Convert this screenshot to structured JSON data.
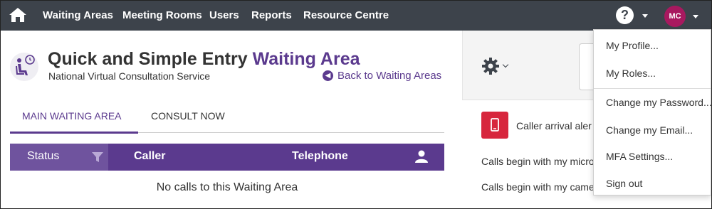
{
  "nav": {
    "items": [
      "Waiting Areas",
      "Meeting Rooms",
      "Users",
      "Reports",
      "Resource Centre"
    ],
    "help_label": "?",
    "avatar_initials": "MC",
    "icons": [
      "home-icon",
      "help-icon",
      "chevron-down-icon"
    ]
  },
  "header": {
    "title_main": "Quick and Simple Entry ",
    "title_accent": "Waiting Area",
    "subtitle": "National Virtual Consultation Service",
    "back_link": "Back to Waiting Areas"
  },
  "tabs": [
    {
      "label": "MAIN WAITING AREA",
      "active": true
    },
    {
      "label": "CONSULT NOW",
      "active": false
    }
  ],
  "table": {
    "columns": [
      "Status",
      "Caller",
      "Telephone"
    ],
    "empty_message": "No calls to this Waiting Area"
  },
  "right_panel": {
    "caller_alert": "Caller arrival aler",
    "mic_text": "Calls begin with my micro",
    "camera_text": "Calls begin with my came"
  },
  "user_menu": {
    "items": [
      "My Profile...",
      "My Roles...",
      "Change my Password...",
      "Change my Email...",
      "MFA Settings...",
      "Sign out"
    ]
  },
  "colors": {
    "nav_bg": "#3d434b",
    "accent": "#5b3a8e",
    "avatar": "#a8195f",
    "alert": "#d7263d"
  }
}
